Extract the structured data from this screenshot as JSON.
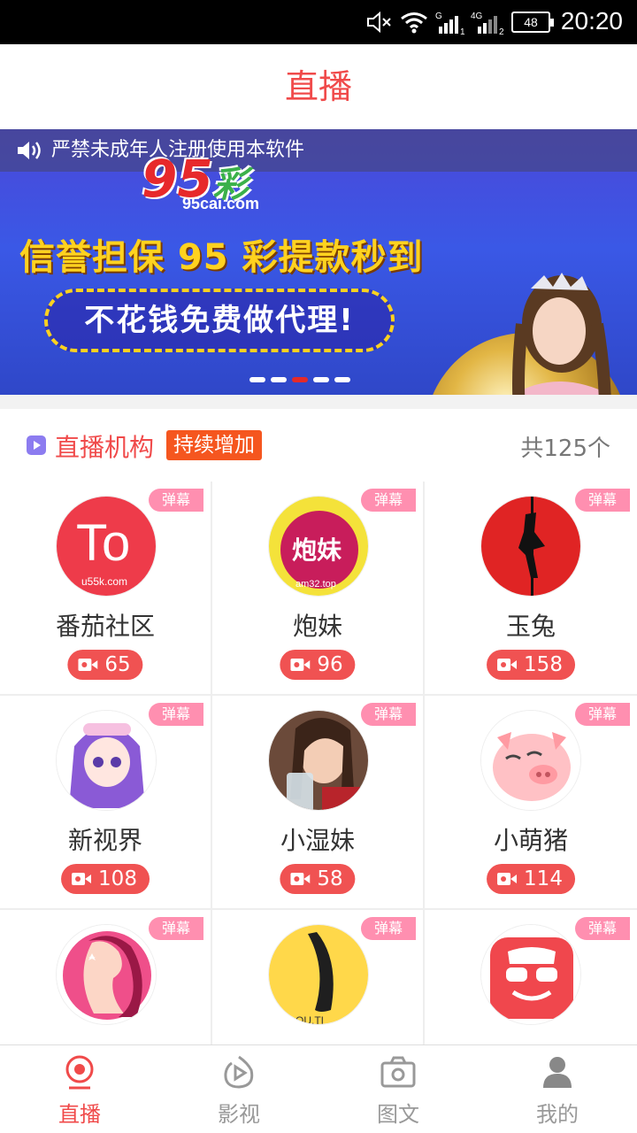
{
  "status_bar": {
    "time": "20:20",
    "battery": "48",
    "net1": "G",
    "net2": "4G"
  },
  "header": {
    "title": "直播"
  },
  "banner": {
    "notice": "严禁未成年人注册使用本软件",
    "logo_number": "95",
    "logo_char": "彩",
    "logo_url": "95cai.com",
    "slogan": "信誉担保 95 彩提款秒到",
    "agent_text": "不花钱免费做代理!",
    "dots_total": 5,
    "dots_active": 3
  },
  "section": {
    "title": "直播机构",
    "tag": "持续增加",
    "count": "共125个"
  },
  "danmu_label": "弹幕",
  "platforms": [
    {
      "name": "番茄社区",
      "viewers": "65",
      "avatar_text": "To",
      "avatar_sub": "u55k.com",
      "avatar_color": "#ee3b4a"
    },
    {
      "name": "炮妹",
      "viewers": "96",
      "avatar_text": "炮妹",
      "avatar_sub": "am32.top",
      "avatar_color": "#c81d5b"
    },
    {
      "name": "玉兔",
      "viewers": "158",
      "avatar_text": "",
      "avatar_sub": "",
      "avatar_color": "#e02424"
    },
    {
      "name": "新视界",
      "viewers": "108",
      "avatar_text": "",
      "avatar_sub": "",
      "avatar_color": "#b9a7ef"
    },
    {
      "name": "小湿妹",
      "viewers": "58",
      "avatar_text": "",
      "avatar_sub": "",
      "avatar_color": "#c9a08a"
    },
    {
      "name": "小萌猪",
      "viewers": "114",
      "avatar_text": "",
      "avatar_sub": "",
      "avatar_color": "#ffd2d5"
    },
    {
      "name": "",
      "viewers": "",
      "avatar_text": "",
      "avatar_sub": "",
      "avatar_color": "#ef4f8a"
    },
    {
      "name": "",
      "viewers": "",
      "avatar_text": "",
      "avatar_sub": "OU.TI",
      "avatar_color": "#ffd84a"
    },
    {
      "name": "",
      "viewers": "",
      "avatar_text": "",
      "avatar_sub": "",
      "avatar_color": "#f0474d"
    }
  ],
  "tabs": [
    {
      "label": "直播",
      "icon": "live-icon",
      "active": true
    },
    {
      "label": "影视",
      "icon": "video-icon",
      "active": false
    },
    {
      "label": "图文",
      "icon": "camera-icon",
      "active": false
    },
    {
      "label": "我的",
      "icon": "user-icon",
      "active": false
    }
  ],
  "colors": {
    "accent": "#f04a4a",
    "tag": "#f5561f",
    "danmu": "#ff8fb0"
  }
}
